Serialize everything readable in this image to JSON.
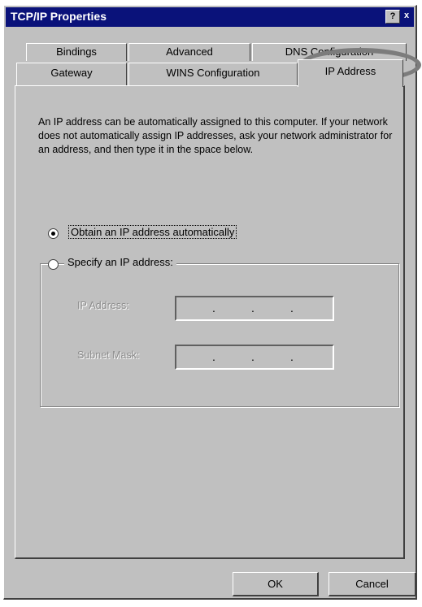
{
  "window": {
    "title": "TCP/IP Properties",
    "help_glyph": "?",
    "close_glyph": "x"
  },
  "tabs": {
    "back_row": [
      "Bindings",
      "Advanced",
      "DNS Configuration"
    ],
    "front_row": [
      "Gateway",
      "WINS Configuration",
      "IP Address"
    ],
    "active": "IP Address"
  },
  "panel": {
    "description": "An IP address can be automatically assigned to this computer. If your network does not automatically assign IP addresses, ask your network administrator for an address, and then type it in the space below.",
    "option_auto": "Obtain an IP address automatically",
    "option_specify": "Specify an IP address:",
    "selected_option": "auto",
    "ip_address_label": "IP Address:",
    "subnet_mask_label": "Subnet Mask:",
    "ip_dots": [
      ".",
      ".",
      "."
    ],
    "mask_dots": [
      ".",
      ".",
      "."
    ]
  },
  "buttons": {
    "ok": "OK",
    "cancel": "Cancel"
  },
  "colors": {
    "title_bar": "#0a127a",
    "face": "#c0c0c0",
    "highlight_ellipse": "#7c7c7c"
  }
}
